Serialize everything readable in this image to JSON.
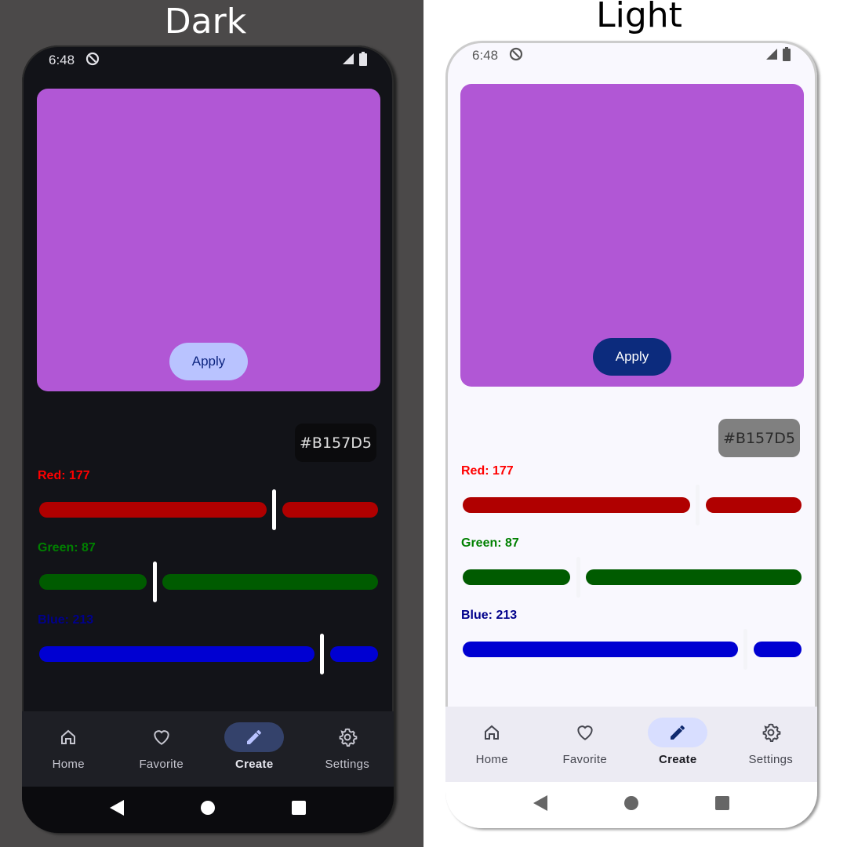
{
  "color_hex": "#B157D5",
  "preview_color": "#b157d5",
  "channels": [
    {
      "label": "Red: 177",
      "value": 177,
      "max": 255,
      "track_color": "#b00000",
      "label_color": "#ff0000"
    },
    {
      "label": "Green: 87",
      "value": 87,
      "max": 255,
      "track_color": "#005b00",
      "label_color": "#008000"
    },
    {
      "label": "Blue: 213",
      "value": 213,
      "max": 255,
      "track_color": "#0000d2",
      "label_color": "#00008b"
    }
  ],
  "apply_label": "Apply",
  "status": {
    "time": "6:48",
    "icons": [
      "do-not-disturb-icon",
      "signal-icon",
      "battery-icon"
    ]
  },
  "nav": {
    "items": [
      {
        "label": "Home",
        "icon": "home-icon"
      },
      {
        "label": "Favorite",
        "icon": "heart-icon"
      },
      {
        "label": "Create",
        "icon": "pencil-icon",
        "selected": true
      },
      {
        "label": "Settings",
        "icon": "gear-icon"
      }
    ]
  },
  "panels": [
    {
      "title": "Dark",
      "theme": "dark"
    },
    {
      "title": "Light",
      "theme": "light"
    }
  ]
}
